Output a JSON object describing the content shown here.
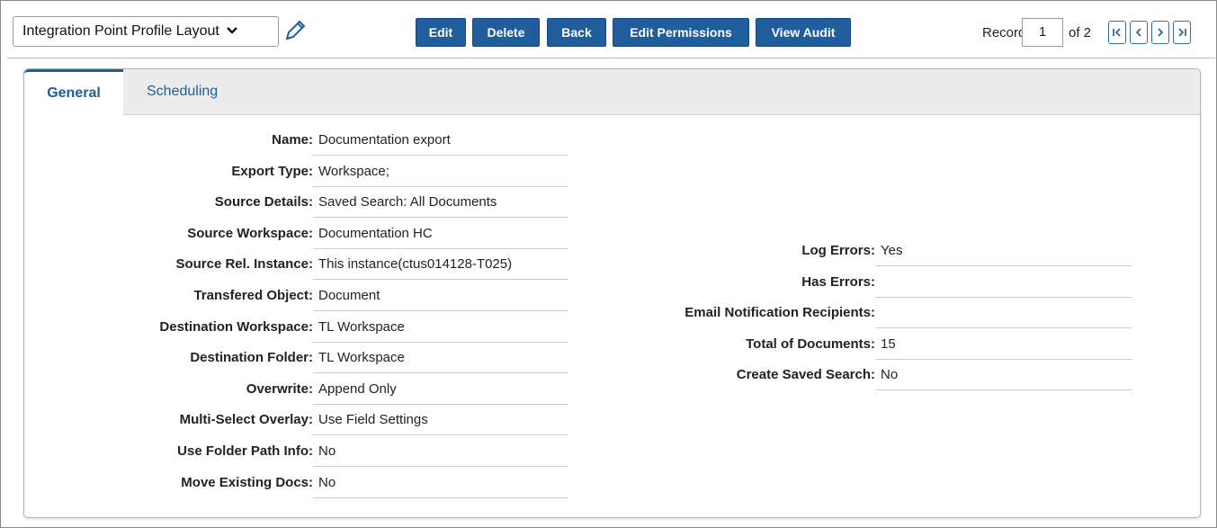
{
  "toolbar": {
    "layout_selected": "Integration Point Profile Layout",
    "buttons": [
      "Edit",
      "Delete",
      "Back",
      "Edit Permissions",
      "View Audit"
    ],
    "record_label": "Record",
    "record_value": "1",
    "record_total": "of 2",
    "pager": [
      "first",
      "previous",
      "next",
      "last"
    ]
  },
  "tabs": [
    {
      "label": "General",
      "active": true
    },
    {
      "label": "Scheduling",
      "active": false
    }
  ],
  "left_fields": [
    {
      "label": "Name:",
      "value": "Documentation export"
    },
    {
      "label": "Export Type:",
      "value": "Workspace;"
    },
    {
      "label": "Source Details:",
      "value": "Saved Search: All Documents"
    },
    {
      "label": "Source Workspace:",
      "value": "Documentation HC"
    },
    {
      "label": "Source Rel. Instance:",
      "value": "This instance(ctus014128-T025)"
    },
    {
      "label": "Transfered Object:",
      "value": "Document"
    },
    {
      "label": "Destination Workspace:",
      "value": "TL Workspace"
    },
    {
      "label": "Destination Folder:",
      "value": "TL Workspace"
    },
    {
      "label": "Overwrite:",
      "value": "Append Only"
    },
    {
      "label": "Multi-Select Overlay:",
      "value": "Use Field Settings"
    },
    {
      "label": "Use Folder Path Info:",
      "value": "No"
    },
    {
      "label": "Move Existing Docs:",
      "value": "No"
    }
  ],
  "right_fields": [
    {
      "label": "Log Errors:",
      "value": "Yes"
    },
    {
      "label": "Has Errors:",
      "value": ""
    },
    {
      "label": "Email Notification Recipients:",
      "value": ""
    },
    {
      "label": "Total of Documents:",
      "value": "15"
    },
    {
      "label": "Create Saved Search:",
      "value": "No"
    }
  ],
  "colors": {
    "button_bg": "#1f5d9c",
    "tab_active": "#1f5d9c",
    "tabbar_bg": "#ececec"
  }
}
